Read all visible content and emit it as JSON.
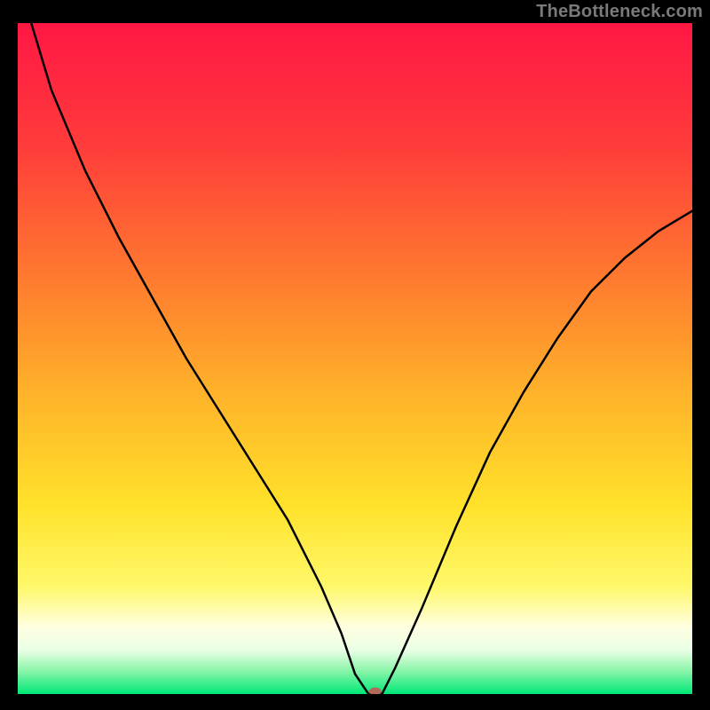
{
  "watermark": "TheBottleneck.com",
  "chart_data": {
    "type": "line",
    "title": "",
    "xlabel": "",
    "ylabel": "",
    "xlim": [
      0,
      100
    ],
    "ylim": [
      0,
      100
    ],
    "grid": false,
    "legend": false,
    "gradient_stops": [
      {
        "offset": 0.0,
        "color": "#ff1744"
      },
      {
        "offset": 0.18,
        "color": "#ff3b3b"
      },
      {
        "offset": 0.38,
        "color": "#ff7a2f"
      },
      {
        "offset": 0.55,
        "color": "#ffb22a"
      },
      {
        "offset": 0.72,
        "color": "#ffe22a"
      },
      {
        "offset": 0.84,
        "color": "#fff86a"
      },
      {
        "offset": 0.9,
        "color": "#ffffe0"
      },
      {
        "offset": 0.935,
        "color": "#e9ffe6"
      },
      {
        "offset": 0.965,
        "color": "#8cf5aa"
      },
      {
        "offset": 1.0,
        "color": "#00e878"
      }
    ],
    "series": [
      {
        "name": "bottleneck-curve",
        "type": "line",
        "x": [
          2,
          5,
          10,
          15,
          20,
          25,
          30,
          35,
          40,
          45,
          48,
          50,
          52,
          54,
          56,
          60,
          65,
          70,
          75,
          80,
          85,
          90,
          95,
          100
        ],
        "y": [
          100,
          90,
          78,
          68,
          59,
          50,
          42,
          34,
          26,
          16,
          9,
          3,
          0,
          0,
          4,
          13,
          25,
          36,
          45,
          53,
          60,
          65,
          69,
          72
        ]
      }
    ],
    "marker": {
      "x": 53,
      "y": 0,
      "color": "#b2695a",
      "rx": 5,
      "ry": 3.5
    }
  }
}
